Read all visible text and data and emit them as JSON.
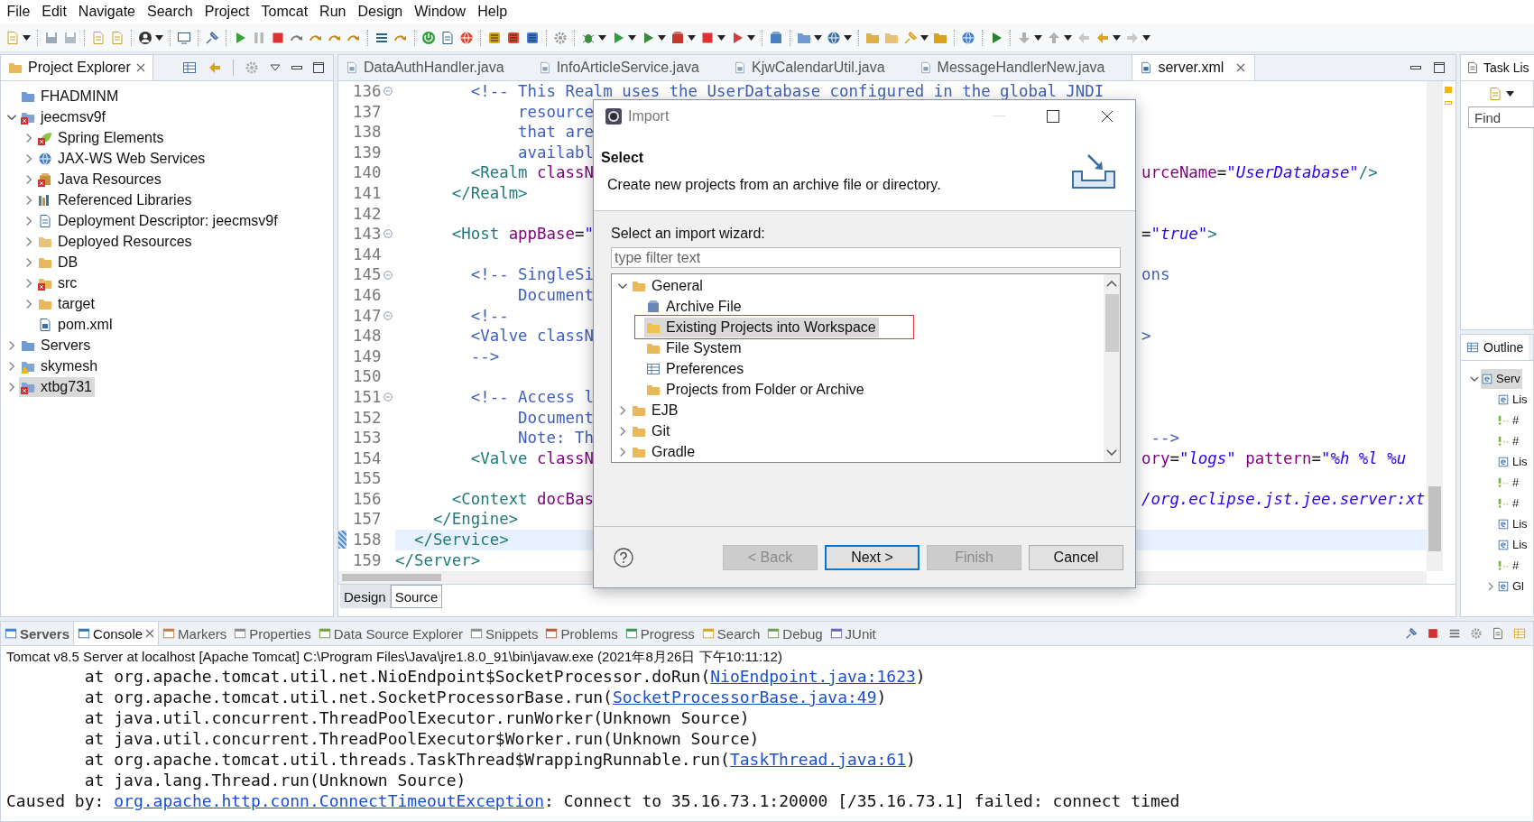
{
  "menu": [
    "File",
    "Edit",
    "Navigate",
    "Search",
    "Project",
    "Tomcat",
    "Run",
    "Design",
    "Window",
    "Help"
  ],
  "project_explorer": {
    "title": "Project Explorer",
    "tree": [
      {
        "label": "FHADMINM",
        "kind": "folder-closed",
        "selected": false,
        "error": false,
        "warning": false
      },
      {
        "label": "jeecmsv9f",
        "kind": "web-project",
        "expanded": true,
        "selected": false,
        "error": true,
        "warning": false,
        "children": [
          {
            "label": "Spring Elements",
            "kind": "spring",
            "expanded": false,
            "selected": false,
            "error": true,
            "warning": false
          },
          {
            "label": "JAX-WS Web Services",
            "kind": "webservices",
            "expanded": false,
            "selected": false,
            "error": false,
            "warning": false
          },
          {
            "label": "Java Resources",
            "kind": "java-resources",
            "expanded": false,
            "selected": false,
            "error": true,
            "warning": false
          },
          {
            "label": "Referenced Libraries",
            "kind": "libraries",
            "expanded": false,
            "selected": false,
            "error": false,
            "warning": false
          },
          {
            "label": "Deployment Descriptor: jeecmsv9f",
            "kind": "descriptor",
            "expanded": false,
            "selected": false,
            "error": false,
            "warning": false
          },
          {
            "label": "Deployed Resources",
            "kind": "deployed",
            "expanded": false,
            "selected": false,
            "error": false,
            "warning": false
          },
          {
            "label": "DB",
            "kind": "folder",
            "expanded": false,
            "selected": false,
            "error": false,
            "warning": false
          },
          {
            "label": "src",
            "kind": "folder",
            "expanded": false,
            "selected": false,
            "error": true,
            "warning": false
          },
          {
            "label": "target",
            "kind": "folder",
            "expanded": false,
            "selected": false,
            "error": false,
            "warning": false
          },
          {
            "label": "pom.xml",
            "kind": "maven-file",
            "selected": false,
            "error": false,
            "warning": false
          }
        ]
      },
      {
        "label": "Servers",
        "kind": "servers",
        "expanded": false,
        "selected": false,
        "error": false,
        "warning": false
      },
      {
        "label": "skymesh",
        "kind": "web-project",
        "expanded": false,
        "selected": false,
        "error": false,
        "warning": true
      },
      {
        "label": "xtbg731",
        "kind": "web-project",
        "expanded": false,
        "selected": true,
        "error": true,
        "warning": false
      }
    ]
  },
  "editor": {
    "tabs": [
      {
        "label": "DataAuthHandler.java",
        "kind": "java",
        "selected": false
      },
      {
        "label": "InfoArticleService.java",
        "kind": "java",
        "selected": false
      },
      {
        "label": "KjwCalendarUtil.java",
        "kind": "java",
        "selected": false
      },
      {
        "label": "MessageHandlerNew.java",
        "kind": "java",
        "selected": false
      },
      {
        "label": "server.xml",
        "kind": "xml",
        "selected": true
      }
    ],
    "lines": [
      {
        "number": "136",
        "fold": true,
        "current": false,
        "left": [
          {
            "kind": "comment",
            "text": "        <!-- This Realm uses the UserDatabase configured in the global JNDI"
          }
        ]
      },
      {
        "number": "137",
        "fold": false,
        "current": false,
        "left": [
          {
            "kind": "comment",
            "text": "             resource"
          }
        ]
      },
      {
        "number": "138",
        "fold": false,
        "current": false,
        "left": [
          {
            "kind": "comment",
            "text": "             that are"
          }
        ]
      },
      {
        "number": "139",
        "fold": false,
        "current": false,
        "left": [
          {
            "kind": "comment",
            "text": "             availabl"
          }
        ]
      },
      {
        "number": "140",
        "fold": false,
        "current": false,
        "left": [
          {
            "kind": "tag",
            "text": "        <Realm"
          },
          {
            "kind": "attr",
            "text": " classN"
          }
        ],
        "right": [
          {
            "kind": "attr",
            "text": "urceName"
          },
          {
            "kind": "plain",
            "text": "="
          },
          {
            "kind": "value",
            "text": "\"UserDatabase\""
          },
          {
            "kind": "tag",
            "text": "/>"
          }
        ]
      },
      {
        "number": "141",
        "fold": false,
        "current": false,
        "left": [
          {
            "kind": "tag",
            "text": "      </Realm>"
          }
        ]
      },
      {
        "number": "142",
        "fold": false,
        "current": false
      },
      {
        "number": "143",
        "fold": true,
        "current": false,
        "left": [
          {
            "kind": "tag",
            "text": "      <Host"
          },
          {
            "kind": "attr",
            "text": " appBase"
          },
          {
            "kind": "plain",
            "text": "="
          },
          {
            "kind": "value",
            "text": "\""
          }
        ],
        "right": [
          {
            "kind": "plain",
            "text": "="
          },
          {
            "kind": "value",
            "text": "\"true\""
          },
          {
            "kind": "tag",
            "text": ">"
          }
        ]
      },
      {
        "number": "144",
        "fold": false,
        "current": false
      },
      {
        "number": "145",
        "fold": true,
        "current": false,
        "left": [
          {
            "kind": "comment",
            "text": "        <!-- SingleSi"
          }
        ],
        "right": [
          {
            "kind": "comment",
            "text": "ons"
          }
        ]
      },
      {
        "number": "146",
        "fold": false,
        "current": false,
        "left": [
          {
            "kind": "comment",
            "text": "             Document"
          }
        ]
      },
      {
        "number": "147",
        "fold": true,
        "current": false,
        "left": [
          {
            "kind": "comment",
            "text": "        <!--"
          }
        ]
      },
      {
        "number": "148",
        "fold": false,
        "current": false,
        "left": [
          {
            "kind": "comment",
            "text": "        <Valve classN"
          }
        ],
        "right": [
          {
            "kind": "comment",
            "text": ">"
          }
        ]
      },
      {
        "number": "149",
        "fold": false,
        "current": false,
        "left": [
          {
            "kind": "comment",
            "text": "        -->"
          }
        ]
      },
      {
        "number": "150",
        "fold": false,
        "current": false
      },
      {
        "number": "151",
        "fold": true,
        "current": false,
        "left": [
          {
            "kind": "comment",
            "text": "        <!-- Access l"
          }
        ]
      },
      {
        "number": "152",
        "fold": false,
        "current": false,
        "left": [
          {
            "kind": "comment",
            "text": "             Document"
          }
        ]
      },
      {
        "number": "153",
        "fold": false,
        "current": false,
        "left": [
          {
            "kind": "comment",
            "text": "             Note: Th"
          }
        ],
        "right": [
          {
            "kind": "comment",
            "text": " -->"
          }
        ]
      },
      {
        "number": "154",
        "fold": false,
        "current": false,
        "left": [
          {
            "kind": "tag",
            "text": "        <Valve"
          },
          {
            "kind": "attr",
            "text": " classN"
          }
        ],
        "right": [
          {
            "kind": "attr",
            "text": "ory"
          },
          {
            "kind": "plain",
            "text": "="
          },
          {
            "kind": "value",
            "text": "\"logs\""
          },
          {
            "kind": "attr",
            "text": " pattern"
          },
          {
            "kind": "plain",
            "text": "="
          },
          {
            "kind": "value",
            "text": "\"%h %l %u"
          }
        ]
      },
      {
        "number": "155",
        "fold": false,
        "current": false
      },
      {
        "number": "156",
        "fold": false,
        "current": false,
        "left": [
          {
            "kind": "tag",
            "text": "      <Context"
          },
          {
            "kind": "attr",
            "text": " docBas"
          }
        ],
        "right": [
          {
            "kind": "value",
            "text": "/org.eclipse.jst.jee.server:xt"
          }
        ]
      },
      {
        "number": "157",
        "fold": false,
        "current": false,
        "left": [
          {
            "kind": "tag",
            "text": "    </Engine>"
          }
        ]
      },
      {
        "number": "158",
        "fold": false,
        "current": true,
        "left": [
          {
            "kind": "tag",
            "text": "  </Service>"
          }
        ]
      },
      {
        "number": "159",
        "fold": false,
        "current": false,
        "left": [
          {
            "kind": "tag",
            "text": "</Server>"
          }
        ]
      }
    ],
    "bottom_tabs": [
      {
        "label": "Design",
        "selected": false
      },
      {
        "label": "Source",
        "selected": true
      }
    ]
  },
  "task_list": {
    "title": "Task Lis",
    "find": {
      "placeholder": "Find"
    }
  },
  "outline": {
    "title": "Outline",
    "tree": [
      {
        "label": "Serv",
        "kind": "element",
        "expanded": true,
        "selected": true,
        "children": [
          {
            "label": "Lis",
            "kind": "element",
            "selected": false
          },
          {
            "label": "#",
            "kind": "comment",
            "selected": false
          },
          {
            "label": "#",
            "kind": "comment",
            "selected": false
          },
          {
            "label": "Lis",
            "kind": "element",
            "selected": false
          },
          {
            "label": "#",
            "kind": "comment",
            "selected": false
          },
          {
            "label": "#",
            "kind": "comment",
            "selected": false
          },
          {
            "label": "Lis",
            "kind": "element",
            "selected": false
          },
          {
            "label": "Lis",
            "kind": "element",
            "selected": false
          },
          {
            "label": "#",
            "kind": "comment",
            "selected": false
          },
          {
            "label": "Gl",
            "kind": "element",
            "expanded": false,
            "selected": false
          }
        ]
      }
    ]
  },
  "console": {
    "tabs": [
      {
        "label": "Servers",
        "selected": false
      },
      {
        "label": "Console",
        "selected": true
      },
      {
        "label": "Markers",
        "selected": false
      },
      {
        "label": "Properties",
        "selected": false
      },
      {
        "label": "Data Source Explorer",
        "selected": false
      },
      {
        "label": "Snippets",
        "selected": false
      },
      {
        "label": "Problems",
        "selected": false
      },
      {
        "label": "Progress",
        "selected": false
      },
      {
        "label": "Search",
        "selected": false
      },
      {
        "label": "Debug",
        "selected": false
      },
      {
        "label": "JUnit",
        "selected": false
      }
    ],
    "header": "Tomcat v8.5 Server at localhost [Apache Tomcat] C:\\Program Files\\Java\\jre1.8.0_91\\bin\\javaw.exe (2021年8月26日 下午10:11:12)",
    "lines": [
      {
        "segments": [
          {
            "kind": "text",
            "text": "        at org.apache.tomcat.util.net.NioEndpoint$SocketProcessor.doRun("
          },
          {
            "kind": "link",
            "text": "NioEndpoint.java:1623"
          },
          {
            "kind": "text",
            "text": ")"
          }
        ]
      },
      {
        "segments": [
          {
            "kind": "text",
            "text": "        at org.apache.tomcat.util.net.SocketProcessorBase.run("
          },
          {
            "kind": "link",
            "text": "SocketProcessorBase.java:49"
          },
          {
            "kind": "text",
            "text": ")"
          }
        ]
      },
      {
        "segments": [
          {
            "kind": "text",
            "text": "        at java.util.concurrent.ThreadPoolExecutor.runWorker(Unknown Source)"
          }
        ]
      },
      {
        "segments": [
          {
            "kind": "text",
            "text": "        at java.util.concurrent.ThreadPoolExecutor$Worker.run(Unknown Source)"
          }
        ]
      },
      {
        "segments": [
          {
            "kind": "text",
            "text": "        at org.apache.tomcat.util.threads.TaskThread$WrappingRunnable.run("
          },
          {
            "kind": "link",
            "text": "TaskThread.java:61"
          },
          {
            "kind": "text",
            "text": ")"
          }
        ]
      },
      {
        "segments": [
          {
            "kind": "text",
            "text": "        at java.lang.Thread.run(Unknown Source)"
          }
        ]
      },
      {
        "segments": [
          {
            "kind": "text",
            "text": "Caused by: "
          },
          {
            "kind": "link",
            "text": "org.apache.http.conn.ConnectTimeoutException"
          },
          {
            "kind": "text",
            "text": ": Connect to 35.16.73.1:20000 [/35.16.73.1] failed: connect timed"
          }
        ]
      }
    ]
  },
  "dialog": {
    "title": "Import",
    "heading": "Select",
    "description": "Create new projects from an archive file or directory.",
    "wizard_label": "Select an import wizard:",
    "filter": {
      "placeholder": "type filter text"
    },
    "tree": [
      {
        "label": "General",
        "kind": "category",
        "expanded": true,
        "selected": false,
        "children": [
          {
            "label": "Archive File",
            "kind": "archive",
            "selected": false
          },
          {
            "label": "Existing Projects into Workspace",
            "kind": "project-folder",
            "selected": true
          },
          {
            "label": "File System",
            "kind": "folder",
            "selected": false
          },
          {
            "label": "Preferences",
            "kind": "preferences",
            "selected": false
          },
          {
            "label": "Projects from Folder or Archive",
            "kind": "folder",
            "selected": false
          }
        ]
      },
      {
        "label": "EJB",
        "kind": "category",
        "expanded": false,
        "selected": false
      },
      {
        "label": "Git",
        "kind": "category",
        "expanded": false,
        "selected": false
      },
      {
        "label": "Gradle",
        "kind": "category",
        "expanded": false,
        "selected": false
      }
    ],
    "buttons": [
      {
        "label": "< Back",
        "disabled": true,
        "default": false
      },
      {
        "label": "Next >",
        "disabled": false,
        "default": true
      },
      {
        "label": "Finish",
        "disabled": true,
        "default": false
      },
      {
        "label": "Cancel",
        "disabled": false,
        "default": false
      }
    ]
  }
}
